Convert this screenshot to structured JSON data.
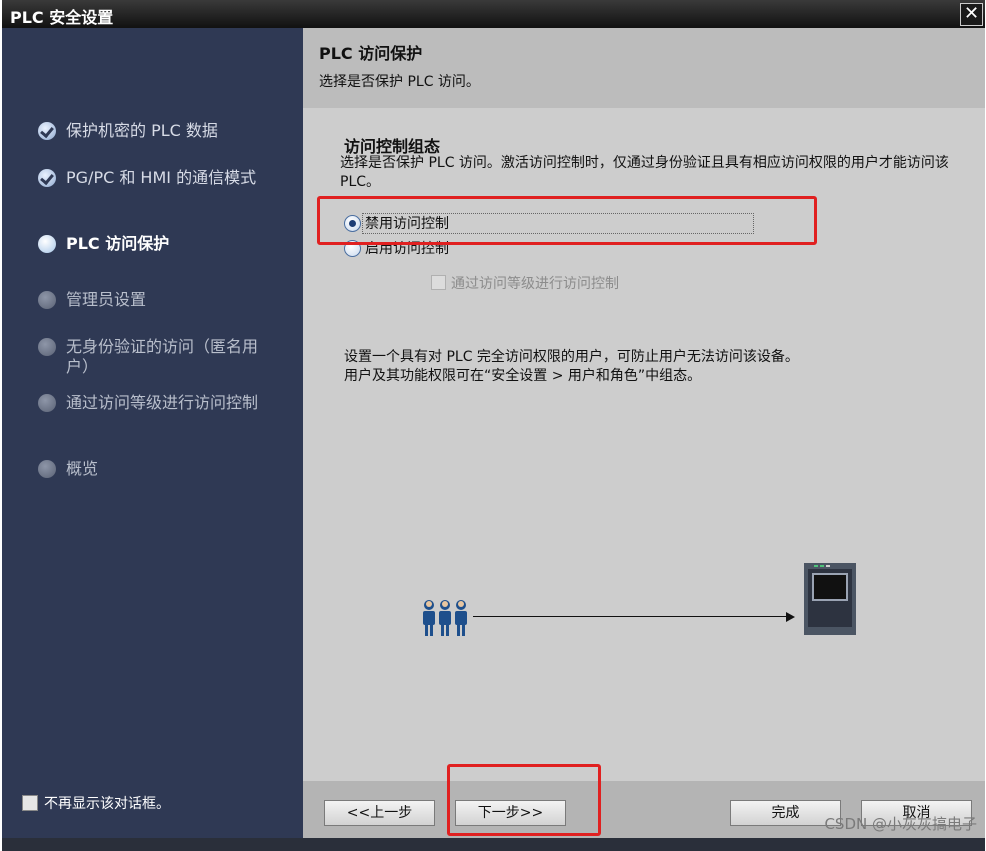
{
  "window": {
    "title": "PLC 安全设置",
    "close_label": "✕"
  },
  "sidebar": {
    "steps": [
      {
        "label": "保护机密的 PLC 数据",
        "state": "done"
      },
      {
        "label": "PG/PC 和 HMI 的通信模式",
        "state": "done"
      },
      {
        "label": "PLC 访问保护",
        "state": "active"
      },
      {
        "label": "管理员设置",
        "state": "pending"
      },
      {
        "label": "无身份验证的访问（匿名用户）",
        "state": "pending"
      },
      {
        "label": "通过访问等级进行访问控制",
        "state": "pending"
      },
      {
        "label": "概览",
        "state": "pending"
      }
    ],
    "dont_show_label": "不再显示该对话框。"
  },
  "header": {
    "title": "PLC 访问保护",
    "subtitle": "选择是否保护 PLC 访问。"
  },
  "section": {
    "title": "访问控制组态",
    "description": "选择是否保护 PLC 访问。激活访问控制时，仅通过身份验证且具有相应访问权限的用户才能访问该 PLC。",
    "options": [
      {
        "label": "禁用访问控制",
        "checked": true
      },
      {
        "label": "启用访问控制",
        "checked": false
      }
    ],
    "sub_checkbox_label": "通过访问等级进行访问控制",
    "info_line1": "设置一个具有对 PLC 完全访问权限的用户，可防止用户无法访问该设备。",
    "info_line2": "用户及其功能权限可在“安全设置 > 用户和角色”中组态。"
  },
  "buttons": {
    "prev": "<<上一步",
    "next": "下一步>>",
    "finish": "完成",
    "cancel": "取消"
  },
  "watermark": "CSDN @小灰灰搞电子",
  "colors": {
    "highlight": "#e02020",
    "sidebar": "#2f3954",
    "content": "#cdcdcd"
  },
  "icons": {
    "users": "users-icon",
    "plc": "plc-device-icon"
  }
}
